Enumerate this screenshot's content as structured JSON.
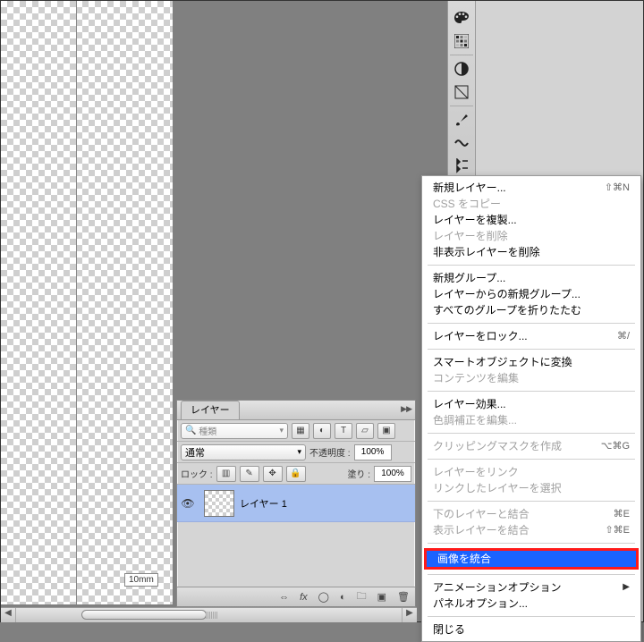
{
  "document": {
    "ruler_mark": "10mm"
  },
  "tool_strip": {
    "icons": [
      "palette",
      "swatches",
      "adjustments",
      "styles",
      "brushes",
      "brush-presets",
      "tool-presets"
    ]
  },
  "layers_panel": {
    "tab_label": "レイヤー",
    "tabs_flyout": "▶▶",
    "filter_label": "種類",
    "blend_mode": "通常",
    "opacity_label": "不透明度 :",
    "opacity_value": "100%",
    "lock_label": "ロック :",
    "fill_label": "塗り :",
    "fill_value": "100%",
    "layer1_name": "レイヤー 1",
    "footer_icons": [
      "link",
      "fx",
      "mask",
      "adjust",
      "group",
      "new",
      "trash"
    ]
  },
  "context_menu": {
    "groups": [
      [
        {
          "label": "新規レイヤー...",
          "shortcut": "⇧⌘N",
          "disabled": false
        },
        {
          "label": "CSS をコピー",
          "disabled": true
        },
        {
          "label": "レイヤーを複製...",
          "disabled": false
        },
        {
          "label": "レイヤーを削除",
          "disabled": true
        },
        {
          "label": "非表示レイヤーを削除",
          "disabled": false
        }
      ],
      [
        {
          "label": "新規グループ...",
          "disabled": false
        },
        {
          "label": "レイヤーからの新規グループ...",
          "disabled": false
        },
        {
          "label": "すべてのグループを折りたたむ",
          "disabled": false
        }
      ],
      [
        {
          "label": "レイヤーをロック...",
          "shortcut": "⌘/",
          "disabled": false
        }
      ],
      [
        {
          "label": "スマートオブジェクトに変換",
          "disabled": false
        },
        {
          "label": "コンテンツを編集",
          "disabled": true
        }
      ],
      [
        {
          "label": "レイヤー効果...",
          "disabled": false
        },
        {
          "label": "色調補正を編集...",
          "disabled": true
        }
      ],
      [
        {
          "label": "クリッピングマスクを作成",
          "shortcut": "⌥⌘G",
          "disabled": true
        }
      ],
      [
        {
          "label": "レイヤーをリンク",
          "disabled": true
        },
        {
          "label": "リンクしたレイヤーを選択",
          "disabled": true
        }
      ],
      [
        {
          "label": "下のレイヤーと結合",
          "shortcut": "⌘E",
          "disabled": true
        },
        {
          "label": "表示レイヤーを結合",
          "shortcut": "⇧⌘E",
          "disabled": true
        }
      ],
      [
        {
          "label": "画像を統合",
          "disabled": false,
          "highlight": true,
          "selected": true
        }
      ],
      [
        {
          "label": "アニメーションオプション",
          "submenu": true,
          "disabled": false
        },
        {
          "label": "パネルオプション...",
          "disabled": false
        }
      ],
      [
        {
          "label": "閉じる",
          "disabled": false
        }
      ]
    ]
  }
}
